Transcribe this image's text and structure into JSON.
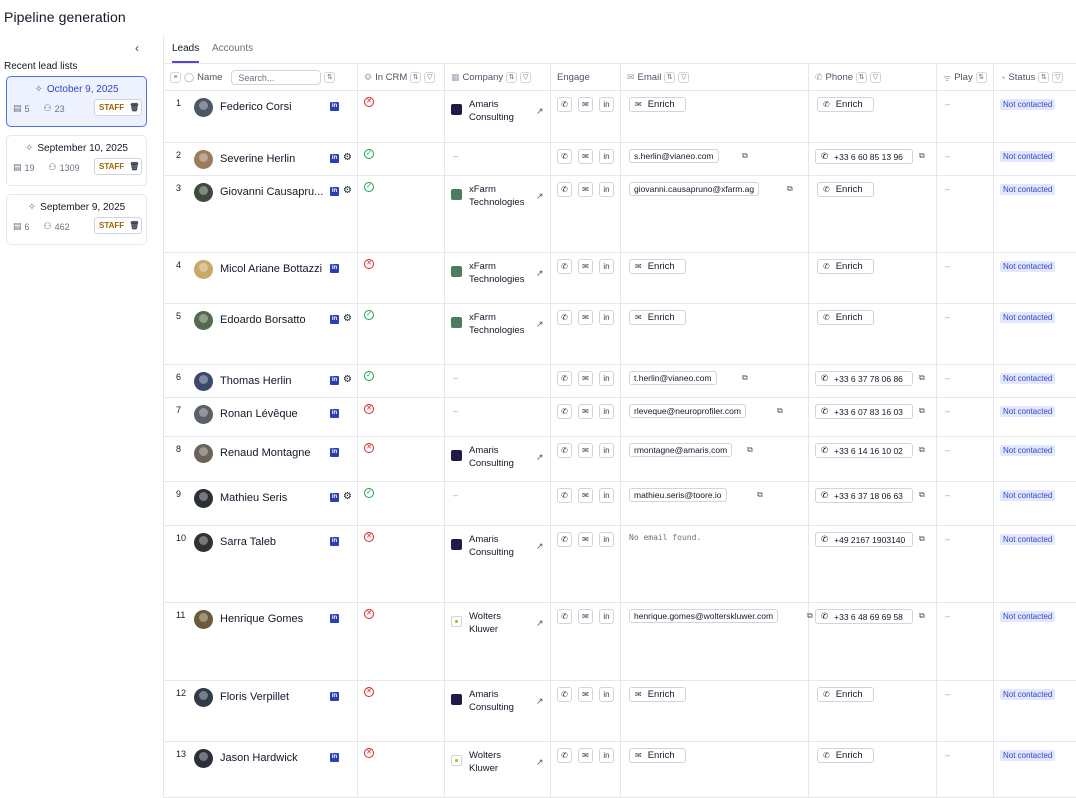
{
  "page_title": "Pipeline generation",
  "sidebar": {
    "collapse_icon": "chevron-left-icon",
    "recent_label": "Recent lead lists",
    "lists": [
      {
        "date": "October 9, 2025",
        "count_a": "5",
        "count_b": "23",
        "badge": "STAFF",
        "active": true
      },
      {
        "date": "September 10, 2025",
        "count_a": "19",
        "count_b": "1309",
        "badge": "STAFF",
        "active": false
      },
      {
        "date": "September 9, 2025",
        "count_a": "6",
        "count_b": "462",
        "badge": "STAFF",
        "active": false
      }
    ]
  },
  "tabs": [
    {
      "label": "Leads",
      "active": true
    },
    {
      "label": "Accounts",
      "active": false
    }
  ],
  "table": {
    "headers": {
      "name": "Name",
      "search_placeholder": "Search...",
      "in_crm": "In CRM",
      "company": "Company",
      "engage": "Engage",
      "email": "Email",
      "phone": "Phone",
      "play": "Play",
      "status": "Status"
    },
    "enrich_label": "Enrich",
    "dash": "–",
    "rows": [
      {
        "num": "1",
        "name": "Federico Corsi",
        "hubspot": false,
        "crm": "no",
        "company": "Amaris Consulting",
        "logo": "amaris",
        "email": null,
        "phone": null,
        "play": "–",
        "status": "Not contacted"
      },
      {
        "num": "2",
        "name": "Severine Herlin",
        "hubspot": true,
        "crm": "yes",
        "company": null,
        "logo": null,
        "email": "s.herlin@vianeo.com",
        "phone": "+33 6 60 85 13 96",
        "play": "–",
        "status": "Not contacted"
      },
      {
        "num": "3",
        "name": "Giovanni Causapru...",
        "hubspot": true,
        "crm": "yes",
        "company": "xFarm Technologies",
        "logo": "xfarm",
        "email": "giovanni.causapruno@xfarm.ag",
        "phone": null,
        "play": "–",
        "status": "Not contacted"
      },
      {
        "num": "4",
        "name": "Micol Ariane Bottazzi",
        "hubspot": false,
        "crm": "no",
        "company": "xFarm Technologies",
        "logo": "xfarm",
        "email": null,
        "phone": null,
        "play": "–",
        "status": "Not contacted"
      },
      {
        "num": "5",
        "name": "Edoardo Borsatto",
        "hubspot": true,
        "crm": "yes",
        "company": "xFarm Technologies",
        "logo": "xfarm",
        "email": null,
        "phone": null,
        "play": "–",
        "status": "Not contacted"
      },
      {
        "num": "6",
        "name": "Thomas Herlin",
        "hubspot": true,
        "crm": "yes",
        "company": null,
        "logo": null,
        "email": "t.herlin@vianeo.com",
        "phone": "+33 6 37 78 06 86",
        "play": "–",
        "status": "Not contacted"
      },
      {
        "num": "7",
        "name": "Ronan Lévêque",
        "hubspot": false,
        "crm": "no",
        "company": null,
        "logo": null,
        "email": "rleveque@neuroprofiler.com",
        "phone": "+33 6 07 83 16 03",
        "play": "–",
        "status": "Not contacted"
      },
      {
        "num": "8",
        "name": "Renaud Montagne",
        "hubspot": false,
        "crm": "no",
        "company": "Amaris Consulting",
        "logo": "amaris",
        "email": "rmontagne@amaris.com",
        "phone": "+33 6 14 16 10 02",
        "play": "–",
        "status": "Not contacted"
      },
      {
        "num": "9",
        "name": "Mathieu Seris",
        "hubspot": true,
        "crm": "yes",
        "company": null,
        "logo": null,
        "email": "mathieu.seris@toore.io",
        "phone": "+33 6 37 18 06 63",
        "play": "–",
        "status": "Not contacted"
      },
      {
        "num": "10",
        "name": "Sarra Taleb",
        "hubspot": false,
        "crm": "no",
        "company": "Amaris Consulting",
        "logo": "amaris",
        "email": "NO_EMAIL",
        "phone": "+49 2167 1903140",
        "play": "–",
        "status": "Not contacted"
      },
      {
        "num": "11",
        "name": "Henrique Gomes",
        "hubspot": false,
        "crm": "no",
        "company": "Wolters Kluwer",
        "logo": "wolters",
        "email": "henrique.gomes@wolterskluwer.com",
        "phone": "+33 6 48 69 69 58",
        "play": "–",
        "status": "Not contacted"
      },
      {
        "num": "12",
        "name": "Floris Verpillet",
        "hubspot": false,
        "crm": "no",
        "company": "Amaris Consulting",
        "logo": "amaris",
        "email": null,
        "phone": null,
        "play": "–",
        "status": "Not contacted"
      },
      {
        "num": "13",
        "name": "Jason Hardwick",
        "hubspot": false,
        "crm": "no",
        "company": "Wolters Kluwer",
        "logo": "wolters",
        "email": null,
        "phone": null,
        "play": "–",
        "status": "Not contacted"
      }
    ],
    "no_email_text": "No email found."
  },
  "colors": {
    "accent": "#4f46e5",
    "status_bg": "#e0e7ff",
    "status_text": "#3347c4",
    "crm_yes": "#16a34a",
    "crm_no": "#dc2626",
    "staff_text": "#a16207"
  }
}
